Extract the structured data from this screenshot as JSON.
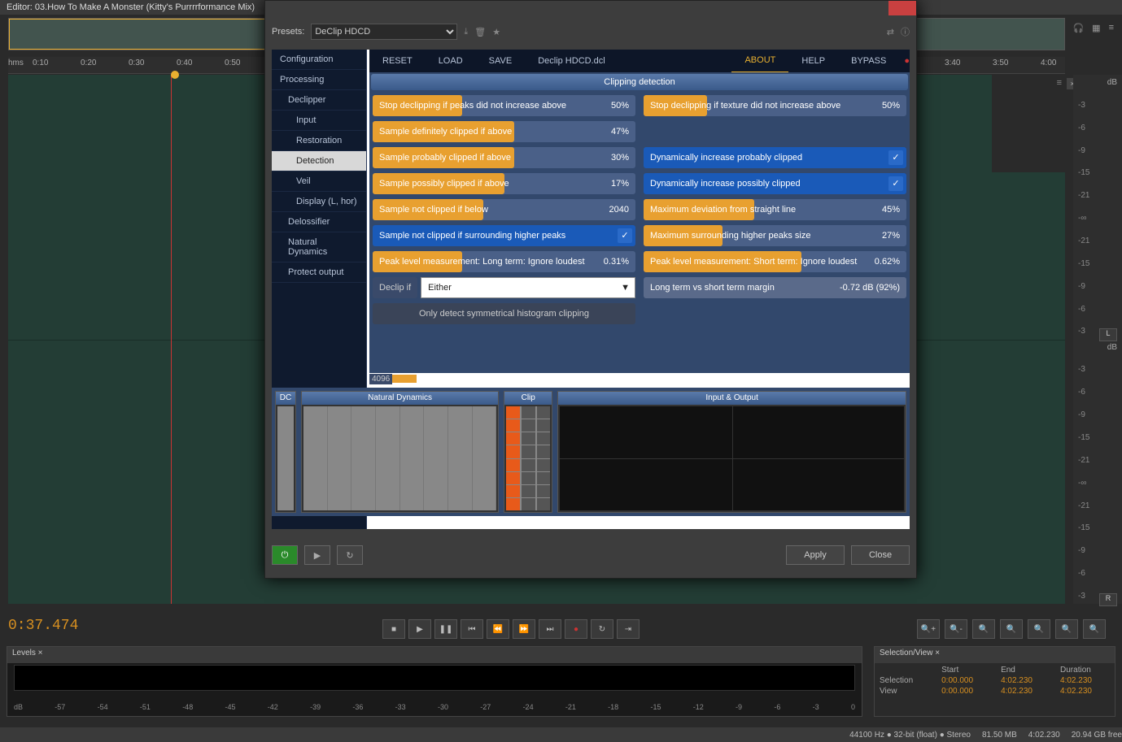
{
  "editor": {
    "title": "Editor: 03.How To Make A Monster (Kitty's Purrrrformance Mix)"
  },
  "timeline": {
    "unit": "hms",
    "marks": [
      "0:10",
      "0:20",
      "0:30",
      "0:40",
      "0:50",
      "",
      "",
      "",
      "",
      "",
      "",
      "",
      "",
      "",
      "",
      "",
      "",
      "",
      "",
      "",
      "",
      "3:40",
      "3:50",
      "4:00"
    ]
  },
  "db": {
    "label": "dB",
    "ticks": [
      "-3",
      "-6",
      "-9",
      "-15",
      "-21",
      "-∞",
      "-21",
      "-15",
      "-9",
      "-6",
      "-3"
    ],
    "left_btn": "L",
    "right_btn": "R"
  },
  "timecode": "0:37.474",
  "levels": {
    "title": "Levels ×",
    "unit": "dB",
    "scale": [
      "-57",
      "-54",
      "-51",
      "-48",
      "-45",
      "-42",
      "-39",
      "-36",
      "-33",
      "-30",
      "-27",
      "-24",
      "-21",
      "-18",
      "-15",
      "-12",
      "-9",
      "-6",
      "-3",
      "0"
    ]
  },
  "selview": {
    "title": "Selection/View ×",
    "headers": [
      "",
      "Start",
      "End",
      "Duration"
    ],
    "rows": [
      [
        "Selection",
        "0:00.000",
        "4:02.230",
        "4:02.230"
      ],
      [
        "View",
        "0:00.000",
        "4:02.230",
        "4:02.230"
      ]
    ]
  },
  "status": [
    "44100 Hz ● 32-bit (float) ● Stereo",
    "81.50 MB",
    "4:02.230",
    "20.94 GB free"
  ],
  "dlg": {
    "presets_lbl": "Presets:",
    "preset": "DeClip HDCD",
    "tree": [
      {
        "t": "Configuration",
        "l": 1
      },
      {
        "t": "Processing",
        "l": 1
      },
      {
        "t": "Declipper",
        "l": 2
      },
      {
        "t": "Input",
        "l": 3
      },
      {
        "t": "Restoration",
        "l": 3
      },
      {
        "t": "Detection",
        "l": 3,
        "sel": true
      },
      {
        "t": "Veil",
        "l": 3
      },
      {
        "t": "Display (L, hor)",
        "l": 3
      },
      {
        "t": "Delossifier",
        "l": 2
      },
      {
        "t": "Natural Dynamics",
        "l": 2
      },
      {
        "t": "Protect output",
        "l": 2
      }
    ],
    "hdr": [
      "RESET",
      "LOAD",
      "SAVE",
      "Declip HDCD.dcl"
    ],
    "hdr2": [
      "ABOUT",
      "HELP",
      "BYPASS"
    ],
    "panel_title": "Clipping detection",
    "sliders": {
      "s1": {
        "t": "Stop declipping if peaks did not increase above",
        "v": "50%",
        "f": 34
      },
      "s2": {
        "t": "Stop declipping if texture did not increase above",
        "v": "50%",
        "f": 24
      },
      "s3": {
        "t": "Sample definitely clipped if above",
        "v": "47%",
        "f": 54
      },
      "s4": {
        "t": "Sample probably clipped if above",
        "v": "30%",
        "f": 54
      },
      "s5": {
        "t": "Dynamically increase probably clipped",
        "chk": true
      },
      "s6": {
        "t": "Sample possibly clipped if above",
        "v": "17%",
        "f": 50
      },
      "s7": {
        "t": "Dynamically increase possibly clipped",
        "chk": true
      },
      "s8": {
        "t": "Sample not clipped if below",
        "v": "2040",
        "f": 42
      },
      "s9": {
        "t": "Maximum deviation from straight line",
        "v": "45%",
        "f": 42
      },
      "s10": {
        "t": "Sample not clipped if surrounding higher peaks",
        "chk": true
      },
      "s11": {
        "t": "Maximum surrounding higher peaks size",
        "v": "27%",
        "f": 30
      },
      "s12": {
        "t": "Peak level measurement: Long term: Ignore loudest",
        "v": "0.31%",
        "f": 34
      },
      "s13": {
        "t": "Peak level measurement: Short term: Ignore loudest",
        "v": "0.62%",
        "f": 60
      },
      "declip_lbl": "Declip if",
      "declip_val": "Either",
      "s14": {
        "t": "Long term vs short term margin",
        "v": "-0.72 dB (92%)"
      },
      "sym": "Only detect symmetrical histogram clipping",
      "num": "4096"
    },
    "meters": {
      "dc": "DC",
      "nd": "Natural Dynamics",
      "clip": "Clip",
      "io": "Input & Output"
    },
    "foot": {
      "apply": "Apply",
      "close": "Close"
    }
  }
}
